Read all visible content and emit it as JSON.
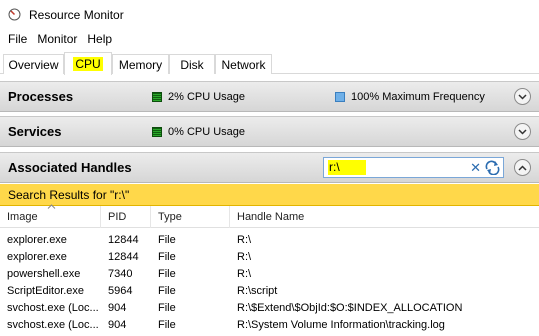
{
  "window": {
    "title": "Resource Monitor",
    "icon": "resource-monitor-icon"
  },
  "menu": [
    "File",
    "Monitor",
    "Help"
  ],
  "tabs": [
    {
      "label": "Overview",
      "active": false
    },
    {
      "label": "CPU",
      "active": true
    },
    {
      "label": "Memory",
      "active": false
    },
    {
      "label": "Disk",
      "active": false
    },
    {
      "label": "Network",
      "active": false
    }
  ],
  "processes": {
    "title": "Processes",
    "usage_label": "2% CPU Usage",
    "frequency_label": "100% Maximum Frequency"
  },
  "services": {
    "title": "Services",
    "usage_label": "0% CPU Usage"
  },
  "handles": {
    "title": "Associated Handles",
    "search_value": "r:\\",
    "results_label": "Search Results for \"r:\\\"",
    "columns": [
      "Image",
      "PID",
      "Type",
      "Handle Name"
    ],
    "rows": [
      [
        "explorer.exe",
        "12844",
        "File",
        "R:\\"
      ],
      [
        "explorer.exe",
        "12844",
        "File",
        "R:\\"
      ],
      [
        "powershell.exe",
        "7340",
        "File",
        "R:\\"
      ],
      [
        "ScriptEditor.exe",
        "5964",
        "File",
        "R:\\script"
      ],
      [
        "svchost.exe (Loc...",
        "904",
        "File",
        "R:\\$Extend\\$ObjId:$O:$INDEX_ALLOCATION"
      ],
      [
        "svchost.exe (Loc...",
        "904",
        "File",
        "R:\\System Volume Information\\tracking.log"
      ]
    ]
  },
  "colors": {
    "highlight": "#ffff00",
    "results_bar": "#ffd84a",
    "cpu_usage_swatch": "#1a7a1a",
    "frequency_swatch": "#6fb0e8"
  }
}
